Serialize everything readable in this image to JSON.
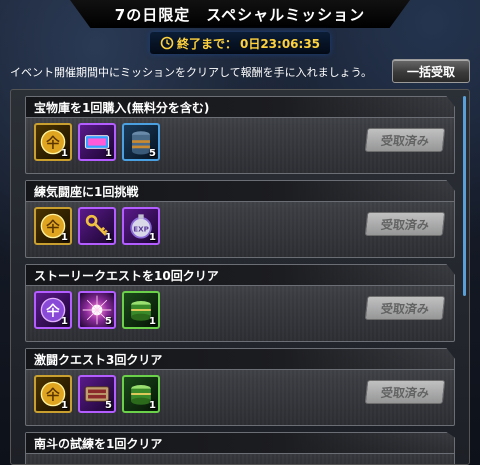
{
  "header": {
    "title": "7の日限定　スペシャルミッション",
    "timer_label": "終了まで：",
    "timer_value": "0日23:06:35"
  },
  "info": {
    "text": "イベント開催期間中にミッションをクリアして報酬を手に入れましょう。",
    "bulk_button": "一括受取"
  },
  "missions": [
    {
      "title": "宝物庫を1回購入(無料分を含む)",
      "status": "受取済み",
      "rewards": [
        {
          "icon": "gold-medal-icon",
          "count": "1",
          "color": "gold"
        },
        {
          "icon": "ticket-icon",
          "count": "1",
          "color": "purple"
        },
        {
          "icon": "barrel-icon",
          "count": "5",
          "color": "blue"
        }
      ]
    },
    {
      "title": "練気闘座に1回挑戦",
      "status": "受取済み",
      "rewards": [
        {
          "icon": "gold-medal-icon",
          "count": "1",
          "color": "gold"
        },
        {
          "icon": "key-icon",
          "count": "1",
          "color": "purple"
        },
        {
          "icon": "exp-pocket-watch-icon",
          "count": "1",
          "color": "purple"
        }
      ]
    },
    {
      "title": "ストーリークエストを10回クリア",
      "status": "受取済み",
      "rewards": [
        {
          "icon": "purple-medal-icon",
          "count": "1",
          "color": "purple"
        },
        {
          "icon": "sparkle-orb-icon",
          "count": "5",
          "color": "purple"
        },
        {
          "icon": "drum-icon",
          "count": "1",
          "color": "green"
        }
      ]
    },
    {
      "title": "激闘クエスト3回クリア",
      "status": "受取済み",
      "rewards": [
        {
          "icon": "gold-medal-icon",
          "count": "1",
          "color": "gold"
        },
        {
          "icon": "bar-ticket-icon",
          "count": "5",
          "color": "purple"
        },
        {
          "icon": "drum-icon",
          "count": "1",
          "color": "green"
        }
      ]
    },
    {
      "title": "南斗の試練を1回クリア"
    }
  ],
  "colors": {
    "accent": "#ffd23d",
    "panel": "#2b2f36"
  }
}
